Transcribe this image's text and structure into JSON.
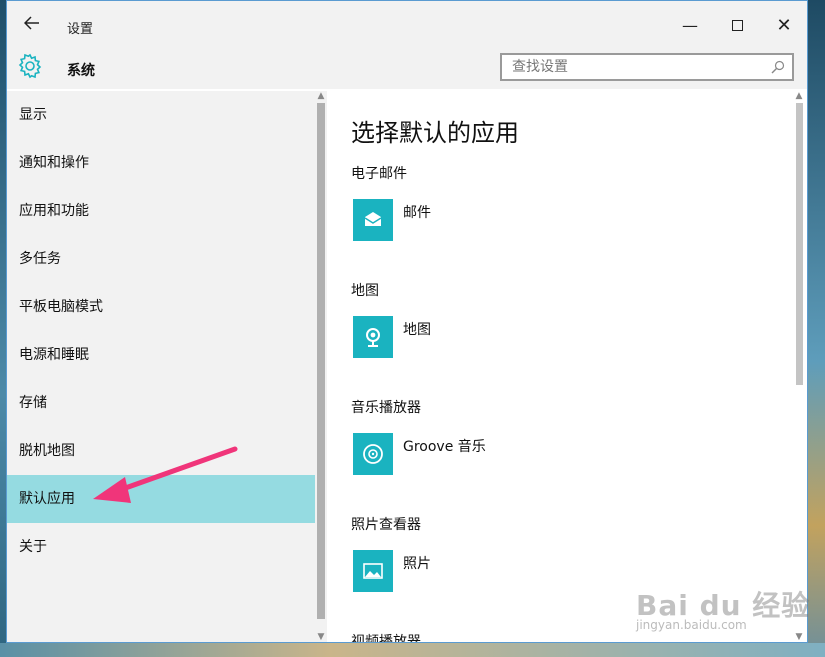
{
  "window": {
    "title": "设置",
    "back_icon": "arrow-left-icon",
    "controls": {
      "minimize": "—",
      "close": "✕"
    }
  },
  "header": {
    "section_title": "系统",
    "search_placeholder": "查找设置"
  },
  "sidebar": {
    "items": [
      {
        "label": "显示"
      },
      {
        "label": "通知和操作"
      },
      {
        "label": "应用和功能"
      },
      {
        "label": "多任务"
      },
      {
        "label": "平板电脑模式"
      },
      {
        "label": "电源和睡眠"
      },
      {
        "label": "存储"
      },
      {
        "label": "脱机地图"
      },
      {
        "label": "默认应用",
        "selected": true
      },
      {
        "label": "关于"
      }
    ]
  },
  "main": {
    "title": "选择默认的应用",
    "categories": [
      {
        "label": "电子邮件",
        "app": "邮件",
        "icon": "mail-icon"
      },
      {
        "label": "地图",
        "app": "地图",
        "icon": "map-pin-icon"
      },
      {
        "label": "音乐播放器",
        "app": "Groove 音乐",
        "icon": "music-disc-icon"
      },
      {
        "label": "照片查看器",
        "app": "照片",
        "icon": "photo-icon"
      },
      {
        "label": "视频播放器"
      }
    ]
  },
  "colors": {
    "accent": "#1ab3c0",
    "selected_bg": "#95dbe1",
    "annotation": "#f0357a"
  },
  "watermark": {
    "text": "Bai du 经验",
    "sub": "jingyan.baidu.com"
  }
}
